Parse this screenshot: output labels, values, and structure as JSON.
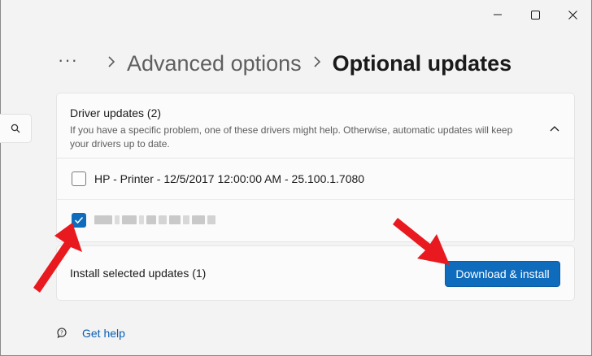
{
  "breadcrumb": {
    "more": "···",
    "separator": ">",
    "parent": "Advanced options",
    "current": "Optional updates"
  },
  "drivers": {
    "title": "Driver updates (2)",
    "description": "If you have a specific problem, one of these drivers might help. Otherwise, automatic updates will keep your drivers up to date.",
    "items": [
      {
        "label": "HP - Printer - 12/5/2017 12:00:00 AM - 25.100.1.7080",
        "checked": false
      },
      {
        "label": "",
        "checked": true,
        "obscured": true
      }
    ]
  },
  "install": {
    "label": "Install selected updates (1)",
    "button": "Download & install"
  },
  "help": {
    "label": "Get help"
  },
  "colors": {
    "accent": "#0f6cbd",
    "annotation_arrow": "#e8191f"
  },
  "icons": [
    "minimize-icon",
    "maximize-icon",
    "close-icon",
    "search-icon",
    "chevron-up-icon",
    "checkmark-icon",
    "help-icon"
  ]
}
